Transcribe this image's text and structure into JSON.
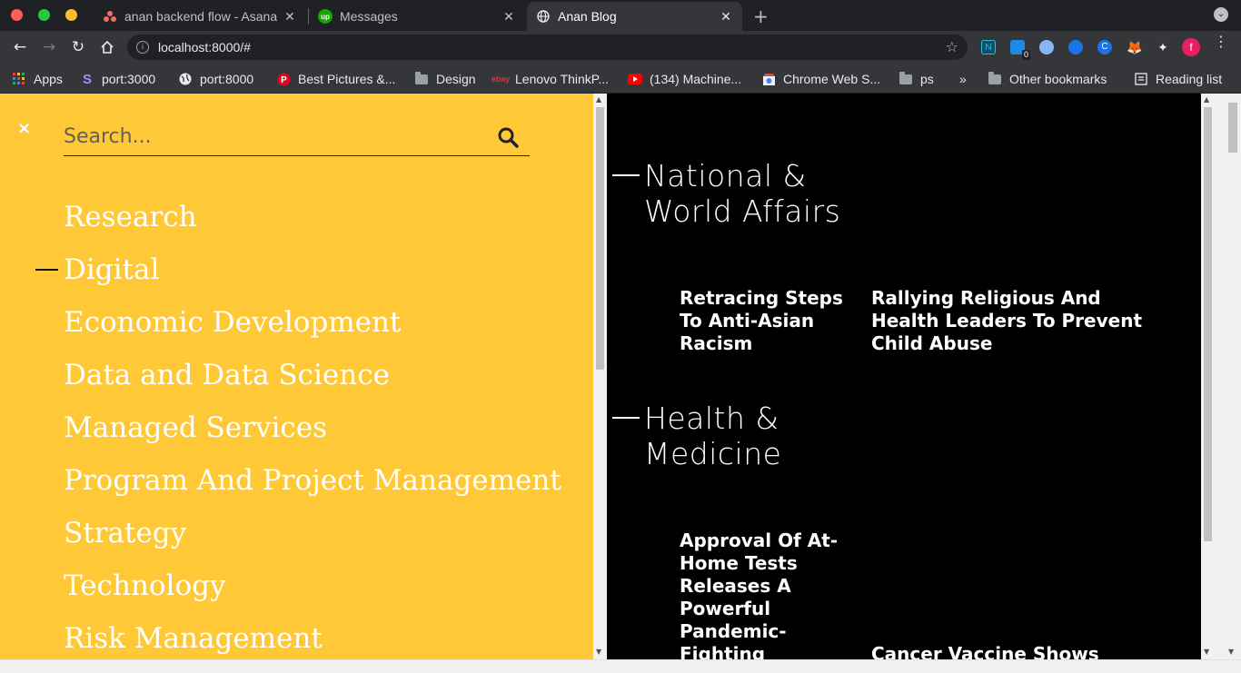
{
  "tabs": [
    {
      "title": "anan backend flow - Asana",
      "favicon": "asana-icon",
      "active": false
    },
    {
      "title": "Messages",
      "favicon": "upwork-icon",
      "active": false
    },
    {
      "title": "Anan Blog",
      "favicon": "globe-icon",
      "active": true
    }
  ],
  "address_bar": {
    "url": "localhost:8000/#"
  },
  "bookmarks": [
    {
      "label": "Apps",
      "icon": "apps-grid-icon"
    },
    {
      "label": "port:3000",
      "icon": "s-logo-icon"
    },
    {
      "label": "port:8000",
      "icon": "globe-icon"
    },
    {
      "label": "Best Pictures &...",
      "icon": "pinterest-icon"
    },
    {
      "label": "Design",
      "icon": "folder-icon"
    },
    {
      "label": "Lenovo ThinkP...",
      "icon": "ebay-icon"
    },
    {
      "label": "(134) Machine...",
      "icon": "youtube-icon"
    },
    {
      "label": "Chrome Web S...",
      "icon": "chrome-store-icon"
    },
    {
      "label": "ps",
      "icon": "folder-icon"
    },
    {
      "label": "»",
      "icon": ""
    },
    {
      "label": "Other bookmarks",
      "icon": "folder-icon"
    },
    {
      "label": "Reading list",
      "icon": "reading-list-icon"
    }
  ],
  "profile_initial": "f",
  "extension_badge": "0",
  "sidebar": {
    "close_label": "×",
    "search_placeholder": "Search...",
    "categories": [
      {
        "label": "Research",
        "active": false
      },
      {
        "label": "Digital",
        "active": true
      },
      {
        "label": "Economic Development",
        "active": false
      },
      {
        "label": "Data and Data Science",
        "active": false
      },
      {
        "label": "Managed Services",
        "active": false
      },
      {
        "label": "Program And Project Management",
        "active": false
      },
      {
        "label": "Strategy",
        "active": false
      },
      {
        "label": "Technology",
        "active": false
      },
      {
        "label": "Risk Management",
        "active": false
      }
    ]
  },
  "sections": [
    {
      "title_line1": "National &",
      "title_line2": "World Affairs",
      "articles": [
        "Retracing Steps To Anti-Asian Racism",
        "Rallying Religious And Health Leaders To Prevent Child Abuse"
      ]
    },
    {
      "title_line1": "Health &",
      "title_line2": "Medicine",
      "articles": [
        "Approval Of At-Home Tests Releases A Powerful Pandemic-Fighting",
        "Cancer Vaccine Shows"
      ]
    }
  ],
  "colors": {
    "sidebar_bg": "#ffc836",
    "content_bg": "#000000",
    "text": "#ffffff"
  }
}
